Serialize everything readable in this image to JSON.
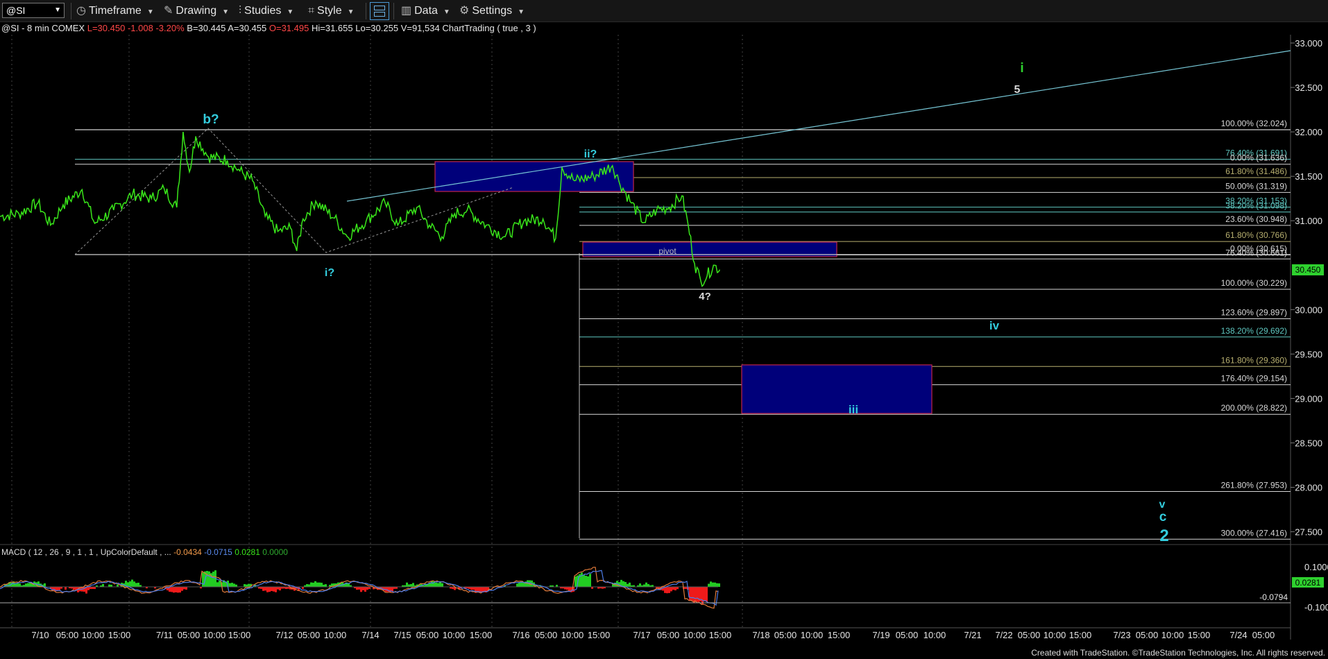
{
  "toolbar": {
    "symbol": "@SI",
    "timeframe": "Timeframe",
    "drawing": "Drawing",
    "studies": "Studies",
    "style": "Style",
    "data": "Data",
    "settings": "Settings"
  },
  "info": {
    "prefix": "@SI - 8 min  COMEX",
    "last": "L=30.450",
    "chg": "-1.008",
    "pct": "-3.20%",
    "bid": "B=30.445",
    "ask": "A=30.455",
    "open": "O=31.495",
    "high": "Hi=31.655",
    "low": "Lo=30.255",
    "vol": "V=91,534",
    "ct": "ChartTrading ( true , 3 )"
  },
  "macd_info": {
    "label": "MACD ( 12 , 26 , 9 , 1 , 1 , UpColorDefault , ...",
    "v1": "-0.0434",
    "v2": "-0.0715",
    "v3": "0.0281",
    "v4": "0.0000"
  },
  "credit": "Created with TradeStation. ©TradeStation Technologies, Inc. All rights reserved.",
  "colors": {
    "price": "#39e61a",
    "fibline": "#c8c8c8",
    "box": "#00007a",
    "boxborder": "#c0254b",
    "wave": "#33ccdd",
    "waveGreen": "#2ed12e",
    "macdUp": "#22cc22",
    "macdDown": "#ee1a1a"
  },
  "chart_data": {
    "type": "line",
    "symbol": "@SI",
    "interval": "8 min",
    "y_axis": {
      "ylim": [
        27.18,
        33.3
      ],
      "ticks": [
        "33.000",
        "32.500",
        "32.000",
        "31.500",
        "31.000",
        "30.000",
        "29.500",
        "29.000",
        "28.500",
        "28.000",
        "27.500"
      ]
    },
    "x_axis": {
      "tick_labels": [
        "7/10",
        "05:00",
        "10:00",
        "15:00",
        "7/11",
        "05:00",
        "10:00",
        "15:00",
        "7/12",
        "05:00",
        "10:00",
        "7/14",
        "7/15",
        "05:00",
        "10:00",
        "15:00",
        "7/16",
        "05:00",
        "10:00",
        "15:00",
        "7/17",
        "05:00",
        "10:00",
        "15:00",
        "7/18",
        "05:00",
        "10:00",
        "15:00",
        "7/19",
        "05:00",
        "10:00",
        "7/21",
        "7/22",
        "05:00",
        "10:00",
        "15:00",
        "7/23",
        "05:00",
        "10:00",
        "15:00",
        "7/24",
        "05:00"
      ]
    },
    "last_price": "30.450",
    "price_path": [
      {
        "i": 0,
        "y": 31.05
      },
      {
        "i": 3,
        "y": 31.08
      },
      {
        "i": 6,
        "y": 31.2
      },
      {
        "i": 8,
        "y": 30.95
      },
      {
        "i": 10,
        "y": 31.18
      },
      {
        "i": 13,
        "y": 31.35
      },
      {
        "i": 15,
        "y": 30.97
      },
      {
        "i": 18,
        "y": 31.12
      },
      {
        "i": 21,
        "y": 31.3
      },
      {
        "i": 24,
        "y": 31.25
      },
      {
        "i": 26,
        "y": 31.36
      },
      {
        "i": 28,
        "y": 31.15
      },
      {
        "i": 29,
        "y": 32.0
      },
      {
        "i": 30,
        "y": 31.55
      },
      {
        "i": 31,
        "y": 31.95
      },
      {
        "i": 33,
        "y": 31.72
      },
      {
        "i": 36,
        "y": 31.68
      },
      {
        "i": 38,
        "y": 31.56
      },
      {
        "i": 40,
        "y": 31.45
      },
      {
        "i": 42,
        "y": 31.05
      },
      {
        "i": 44,
        "y": 30.88
      },
      {
        "i": 46,
        "y": 30.92
      },
      {
        "i": 47,
        "y": 30.66
      },
      {
        "i": 48,
        "y": 31.02
      },
      {
        "i": 50,
        "y": 31.22
      },
      {
        "i": 53,
        "y": 31.03
      },
      {
        "i": 55,
        "y": 30.82
      },
      {
        "i": 58,
        "y": 31.0
      },
      {
        "i": 61,
        "y": 31.2
      },
      {
        "i": 63,
        "y": 30.95
      },
      {
        "i": 66,
        "y": 31.15
      },
      {
        "i": 68,
        "y": 30.95
      },
      {
        "i": 70,
        "y": 30.82
      },
      {
        "i": 72,
        "y": 31.08
      },
      {
        "i": 74,
        "y": 31.12
      },
      {
        "i": 77,
        "y": 30.95
      },
      {
        "i": 80,
        "y": 30.82
      },
      {
        "i": 83,
        "y": 31.0
      },
      {
        "i": 86,
        "y": 31.02
      },
      {
        "i": 88,
        "y": 30.8
      },
      {
        "i": 89,
        "y": 31.6
      },
      {
        "i": 91,
        "y": 31.45
      },
      {
        "i": 94,
        "y": 31.5
      },
      {
        "i": 97,
        "y": 31.62
      },
      {
        "i": 98,
        "y": 31.45
      },
      {
        "i": 100,
        "y": 31.2
      },
      {
        "i": 102,
        "y": 30.98
      },
      {
        "i": 104,
        "y": 31.12
      },
      {
        "i": 106,
        "y": 31.15
      },
      {
        "i": 108,
        "y": 31.28
      },
      {
        "i": 109,
        "y": 30.95
      },
      {
        "i": 110,
        "y": 30.52
      },
      {
        "i": 111,
        "y": 30.32
      },
      {
        "i": 112,
        "y": 30.38
      },
      {
        "i": 113,
        "y": 30.5
      },
      {
        "i": 114,
        "y": 30.45
      }
    ],
    "horizontal_levels": [
      {
        "label": "100.00% (32.024)",
        "y": 32.024
      },
      {
        "label": "76.40% (31.691)",
        "y": 31.691
      },
      {
        "label": "0.00% (31.636)",
        "y": 31.636
      },
      {
        "label": "61.80% (31.486)",
        "y": 31.486
      },
      {
        "label": "50.00% (31.319)",
        "y": 31.319
      },
      {
        "label": "38.20% (31.153)",
        "y": 31.153
      },
      {
        "label": "38.20% (31.098)",
        "y": 31.098
      },
      {
        "label": "23.60% (30.948)",
        "y": 30.948
      },
      {
        "label": "61.80% (30.766)",
        "y": 30.766
      },
      {
        "label": "0.00% (30.615)",
        "y": 30.615
      },
      {
        "label": "76.40% (30.661)",
        "y": 30.57
      },
      {
        "label": "100.00% (30.229)",
        "y": 30.229
      },
      {
        "label": "123.60% (29.897)",
        "y": 29.897
      },
      {
        "label": "138.20% (29.692)",
        "y": 29.692
      },
      {
        "label": "161.80% (29.360)",
        "y": 29.36
      },
      {
        "label": "176.40% (29.154)",
        "y": 29.154
      },
      {
        "label": "200.00% (28.822)",
        "y": 28.822
      },
      {
        "label": "261.80% (27.953)",
        "y": 27.953
      },
      {
        "label": "300.00% (27.416)",
        "y": 27.416
      }
    ],
    "annotations": [
      "b?",
      "i?",
      "ii?",
      "4?",
      "pivot",
      "iii",
      "iv",
      "i",
      "5",
      "v",
      "c",
      "2"
    ],
    "macd": {
      "params": "12, 26, 9",
      "value_label": "0.0281",
      "level_label": "-0.0794",
      "ticks": [
        "0.1000",
        "-0.1000"
      ]
    }
  }
}
